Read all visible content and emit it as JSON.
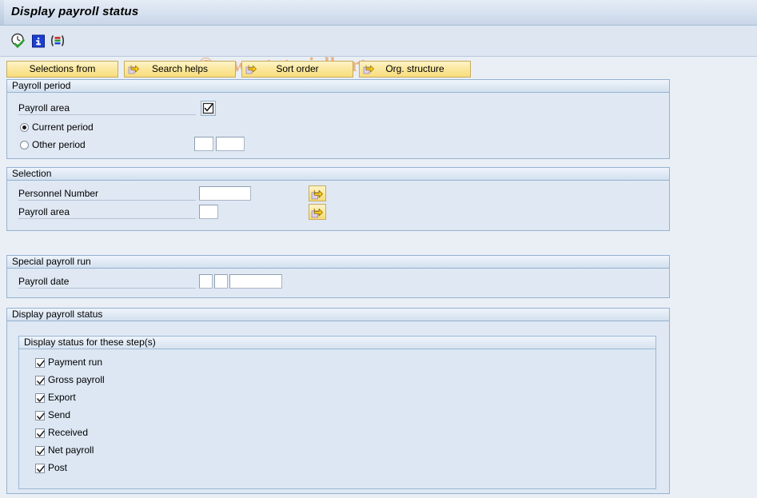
{
  "window": {
    "title": "Display payroll status"
  },
  "watermark": "© www.tutorialkart.com",
  "toolbar": {
    "icons": [
      {
        "name": "execute-clock-check-icon",
        "title": "Execute"
      },
      {
        "name": "info-icon",
        "title": "Information"
      },
      {
        "name": "selection-options-icon",
        "title": "Selection options"
      }
    ]
  },
  "button_bar": {
    "buttons": [
      {
        "label": "Selections from",
        "has_arrow": false
      },
      {
        "label": "Search helps",
        "has_arrow": true
      },
      {
        "label": "Sort order",
        "has_arrow": true
      },
      {
        "label": "Org. structure",
        "has_arrow": true
      }
    ]
  },
  "sections": {
    "payroll_period": {
      "header": "Payroll period",
      "payroll_area_label": "Payroll area",
      "payroll_area_value": "",
      "match_button_icon": "checkbox-check-icon",
      "current_period_label": "Current period",
      "current_period_selected": true,
      "other_period_label": "Other period",
      "other_period_selected": false,
      "other_period_value_1": "",
      "other_period_value_2": ""
    },
    "selection": {
      "header": "Selection",
      "rows": [
        {
          "label": "Personnel Number",
          "value": ""
        },
        {
          "label": "Payroll area",
          "value": ""
        }
      ],
      "multi_select_icon": "yellow-arrow-icon"
    },
    "special_payroll_run": {
      "header": "Special payroll run",
      "payroll_date_label": "Payroll date",
      "payroll_date_value_1": "",
      "payroll_date_value_2": "",
      "payroll_date_value_3": ""
    },
    "display_payroll_status": {
      "header": "Display payroll status",
      "subgroup_header": "Display status for these step(s)",
      "steps": [
        {
          "label": "Payment run",
          "checked": true
        },
        {
          "label": "Gross payroll",
          "checked": true
        },
        {
          "label": "Export",
          "checked": true
        },
        {
          "label": "Send",
          "checked": true
        },
        {
          "label": "Received",
          "checked": true
        },
        {
          "label": "Net payroll",
          "checked": true
        },
        {
          "label": "Post",
          "checked": true
        }
      ]
    }
  },
  "colors": {
    "page_background": "#eaeff6",
    "section_fill": "#dfe8f3",
    "section_border": "#95b2d0",
    "button_yellow": "#fbe89e",
    "watermark": "#e8b488",
    "titlebar": "#d6e1ef"
  }
}
